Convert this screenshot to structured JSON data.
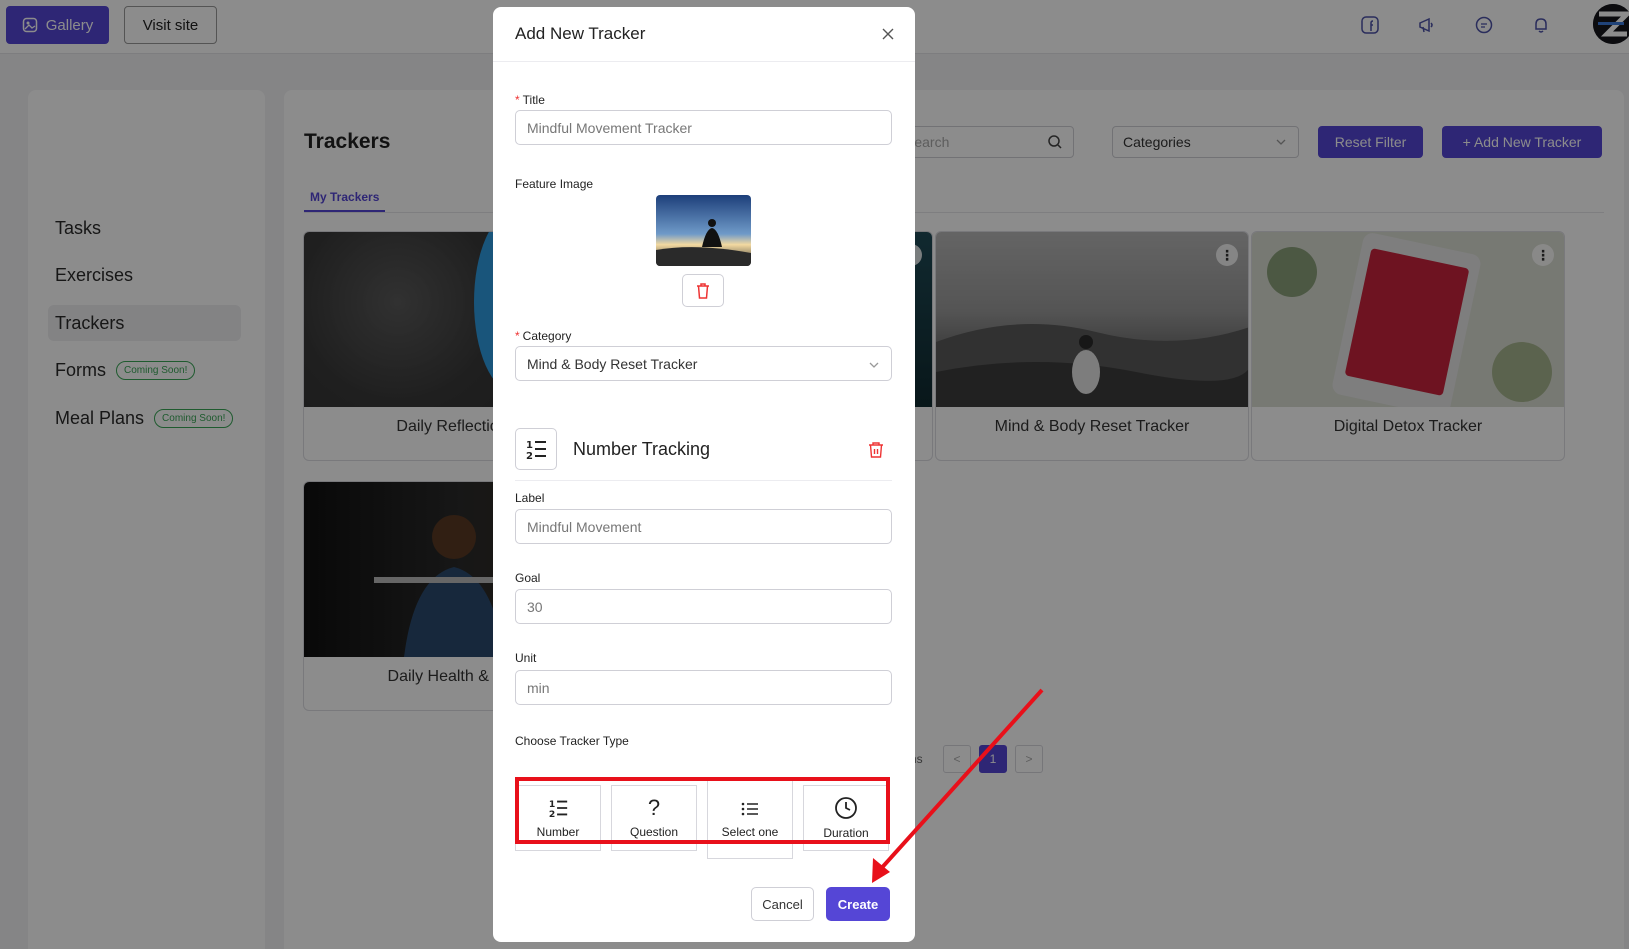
{
  "topbar": {
    "gallery_label": "Gallery",
    "visit_label": "Visit site"
  },
  "sidebar": {
    "items": [
      {
        "label": "Tasks"
      },
      {
        "label": "Exercises"
      },
      {
        "label": "Trackers",
        "active": true
      },
      {
        "label": "Forms",
        "badge": "Coming Soon!"
      },
      {
        "label": "Meal Plans",
        "badge": "Coming Soon!"
      }
    ]
  },
  "main": {
    "title": "Trackers",
    "tab": "My Trackers",
    "search_placeholder": "Search",
    "categories_label": "Categories",
    "reset_label": "Reset Filter",
    "add_label": "+ Add New Tracker",
    "cards": [
      {
        "name": "Daily Reflection R"
      },
      {
        "name": "Mind & Body Reset Tracker"
      },
      {
        "name": "Digital Detox Tracker"
      },
      {
        "name": "Daily Health & Progr"
      }
    ],
    "pager_text": "items",
    "pager_prev": "<",
    "pager_current": "1",
    "pager_next": ">"
  },
  "modal": {
    "title": "Add New Tracker",
    "title_label": "Title",
    "title_value": "Mindful Movement Tracker",
    "feature_image_label": "Feature Image",
    "category_label": "Category",
    "category_value": "Mind & Body Reset Tracker",
    "tracking_title": "Number Tracking",
    "label_label": "Label",
    "label_value": "Mindful Movement",
    "goal_label": "Goal",
    "goal_value": "30",
    "unit_label": "Unit",
    "unit_value": "min",
    "tracker_type_label": "Choose Tracker Type",
    "types": [
      {
        "label": "Number",
        "icon": "number-list-icon"
      },
      {
        "label": "Question",
        "icon": "question-icon"
      },
      {
        "label": "Select one",
        "icon": "list-icon"
      },
      {
        "label": "Duration",
        "icon": "clock-icon"
      }
    ],
    "cancel_label": "Cancel",
    "create_label": "Create"
  },
  "colors": {
    "accent": "#5546d6",
    "annotation": "#e8101a"
  }
}
